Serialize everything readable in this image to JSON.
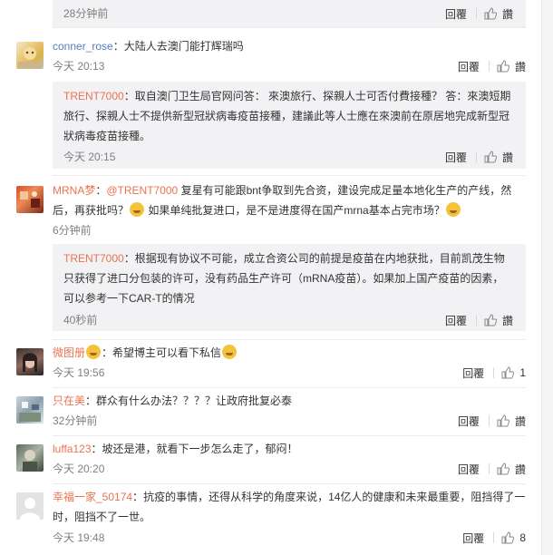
{
  "icons": {
    "like": "thumbs-up-icon",
    "emoji": "smiley-emoji-icon"
  },
  "colors": {
    "name": "#eb7350",
    "mention": "#eb7350",
    "reply_bg": "#f2f2f5"
  },
  "reply_label": "回覆",
  "like_label": "讚",
  "top_reply": {
    "time": "28分钟前"
  },
  "comments": [
    {
      "user": "conner_rose",
      "sep": "：",
      "text": "大陆人去澳门能打辉瑞吗",
      "time": "今天 20:13",
      "reply": {
        "user": "TRENT7000",
        "sep": "：",
        "text": "取自澳门卫生局官网问答： 來澳旅行、探親人士可否付費接種？ 答：來澳短期旅行、探親人士不提供新型冠狀病毒疫苗接種，建議此等人士應在來澳前在原居地完成新型冠狀病毒疫苗接種。",
        "time": "今天 20:15"
      }
    },
    {
      "user": "MRNA梦",
      "sep": "：",
      "mention": "@TRENT7000",
      "text1": " 复星有可能跟bnt争取到先合资，建设完成足量本地化生产的产线，然后，再获批吗？",
      "text2": " 如果单纯批复进口，是不是进度得在国产mrna基本占完市场？",
      "time": "6分钟前",
      "reply": {
        "user": "TRENT7000",
        "sep": "：",
        "text": "根据现有协议不可能，成立合资公司的前提是疫苗在内地获批，目前凯茂生物只获得了进口分包装的许可，没有药品生产许可（mRNA疫苗）。如果加上国产疫苗的因素，可以参考一下CAR-T的情况",
        "time": "40秒前"
      }
    },
    {
      "user": "微图册",
      "sep": "：",
      "text": "希望博主可以看下私信",
      "time": "今天 19:56",
      "likes": "1"
    },
    {
      "user": "只在美",
      "sep": "：",
      "text": "群众有什么办法？？？？让政府批复必泰",
      "time": "32分钟前"
    },
    {
      "user": "luffa123",
      "sep": "：",
      "text": "坡还是港，就看下一步怎么走了，郁闷！",
      "time": "今天 20:20"
    },
    {
      "user": "幸福一家_50174",
      "sep": "：",
      "text": "抗疫的事情，还得从科学的角度来说，14亿人的健康和未来最重要，阻挡得了一时，阻挡不了一世。",
      "time": "今天 19:48",
      "likes": "8"
    }
  ]
}
